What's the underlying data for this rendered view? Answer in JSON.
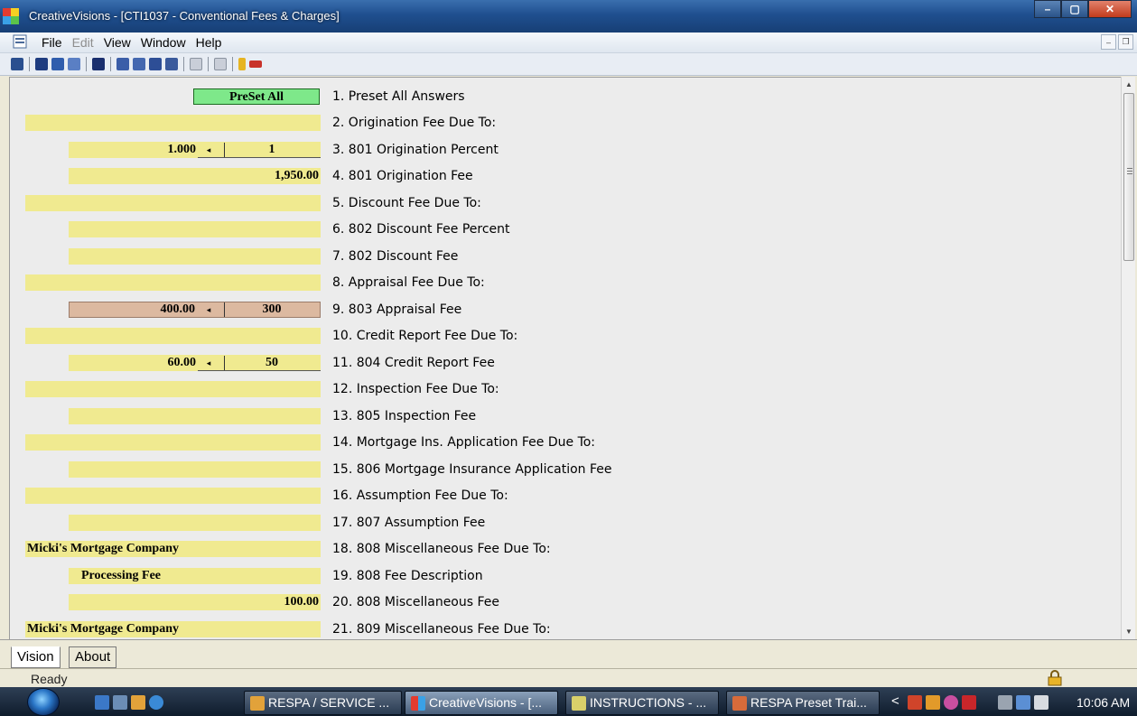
{
  "window": {
    "title": "CreativeVisions - [CTI1037 - Conventional Fees & Charges]",
    "controls": {
      "minimize": "–",
      "maximize": "▢",
      "close": "✕"
    }
  },
  "menu": {
    "items": [
      "File",
      "Edit",
      "View",
      "Window",
      "Help"
    ],
    "disabled": [
      "Edit"
    ]
  },
  "form": {
    "preset_button": "PreSet All",
    "rows": [
      {
        "label": "1. Preset All Answers"
      },
      {
        "label": "2. Origination Fee Due To:",
        "value": ""
      },
      {
        "label": "3. 801 Origination Percent",
        "value": "1.000",
        "alt": "1"
      },
      {
        "label": "4. 801 Origination Fee",
        "value": "1,950.00"
      },
      {
        "label": "5. Discount Fee Due To:",
        "value": ""
      },
      {
        "label": "6. 802 Discount Fee Percent",
        "value": ""
      },
      {
        "label": "7. 802 Discount Fee",
        "value": ""
      },
      {
        "label": "8. Appraisal Fee Due To:",
        "value": ""
      },
      {
        "label": "9. 803 Appraisal Fee",
        "value": "400.00",
        "alt": "300"
      },
      {
        "label": "10.  Credit Report Fee Due To:",
        "value": ""
      },
      {
        "label": "11. 804 Credit Report Fee",
        "value": "60.00",
        "alt": "50"
      },
      {
        "label": "12. Inspection Fee Due To:",
        "value": ""
      },
      {
        "label": "13. 805 Inspection Fee",
        "value": ""
      },
      {
        "label": "14. Mortgage Ins. Application Fee Due To:",
        "value": ""
      },
      {
        "label": "15. 806 Mortgage Insurance Application Fee",
        "value": ""
      },
      {
        "label": "16. Assumption Fee Due To:",
        "value": ""
      },
      {
        "label": "17. 807 Assumption Fee",
        "value": ""
      },
      {
        "label": "18. 808 Miscellaneous Fee Due To:",
        "value": "Micki's Mortgage Company"
      },
      {
        "label": "19. 808 Fee Description",
        "value": "Processing Fee"
      },
      {
        "label": "20. 808 Miscellaneous Fee",
        "value": "100.00"
      },
      {
        "label": "21. 809 Miscellaneous Fee Due To:",
        "value": "Micki's Mortgage Company"
      }
    ],
    "arrow_glyph": "◂",
    "colors": {
      "field": "#f0ea90",
      "modified": "#dcb9a0",
      "preset": "#7ee88a"
    }
  },
  "tabs": [
    "Vision",
    "About"
  ],
  "status": {
    "text": "Ready"
  },
  "taskbar": {
    "buttons": [
      {
        "label": "RESPA / SERVICE ...",
        "icon": "folder-icon"
      },
      {
        "label": "CreativeVisions - [...",
        "icon": "creativevisions-icon",
        "active": true
      },
      {
        "label": "INSTRUCTIONS - ...",
        "icon": "document-icon"
      },
      {
        "label": "RESPA Preset Trai...",
        "icon": "presentation-icon"
      }
    ],
    "tray_chevron": "<",
    "clock": "10:06 AM"
  }
}
